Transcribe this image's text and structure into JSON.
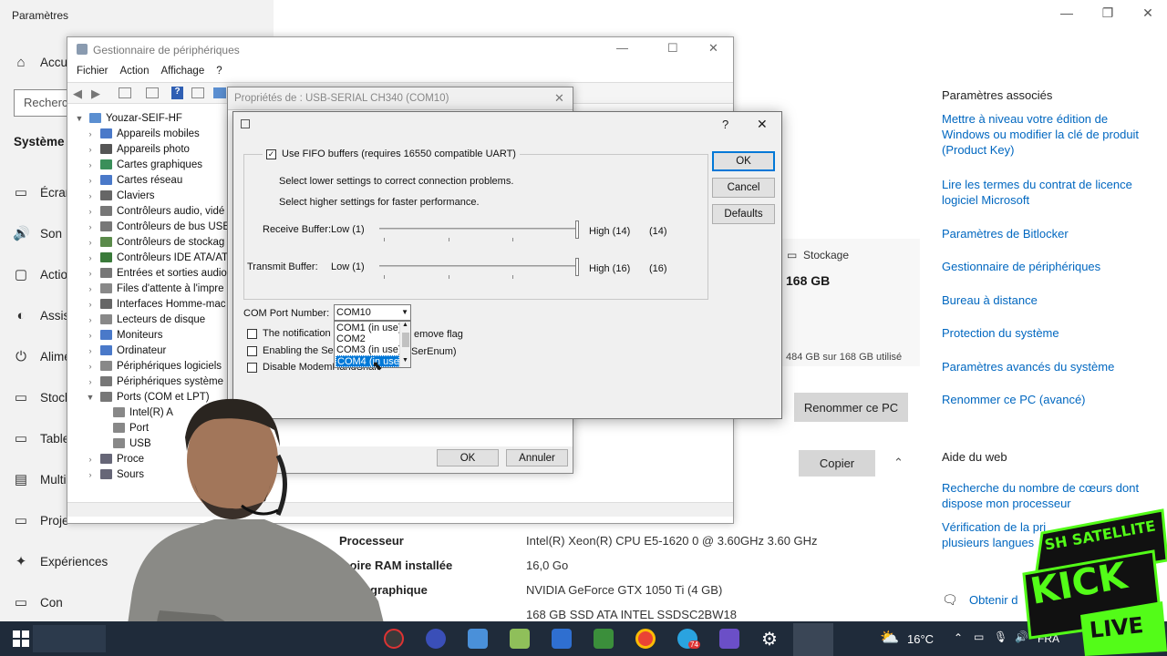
{
  "settings": {
    "window_title": "Paramètres",
    "search_placeholder": "Recherc",
    "nav_home": "Accu",
    "section_title": "Système",
    "nav_items": [
      "Écran",
      "Son",
      "Actio",
      "Assis",
      "Alime",
      "Stock",
      "Table",
      "Multi",
      "Proje",
      "Expériences",
      "Con"
    ],
    "storage_label": "Stockage",
    "storage_size": "168 GB",
    "storage_usage": "484 GB sur 168 GB utilisé",
    "rename_button": "Renommer ce PC",
    "copy_button": "Copier",
    "specs": [
      {
        "label": "Processeur",
        "value": "Intel(R) Xeon(R) CPU E5-1620 0 @ 3.60GHz   3.60 GHz"
      },
      {
        "label": "moire RAM installée",
        "value": "16,0 Go"
      },
      {
        "label": "graphique",
        "value": "NVIDIA GeForce GTX 1050 Ti (4 GB)"
      },
      {
        "label": "e",
        "value": "168 GB SSD ATA INTEL SSDSC2BW18"
      }
    ],
    "related_title": "Paramètres associés",
    "related_links": [
      "Mettre à niveau votre édition de Windows ou modifier la clé de produit (Product Key)",
      "Lire les termes du contrat de licence logiciel Microsoft",
      "Paramètres de Bitlocker",
      "Gestionnaire de périphériques",
      "Bureau à distance",
      "Protection du système",
      "Paramètres avancés du système",
      "Renommer ce PC (avancé)"
    ],
    "web_help_title": "Aide du web",
    "web_help_links": [
      "Recherche du nombre de cœurs dont dispose mon processeur",
      "Vérification de la pri plusieurs langues"
    ],
    "get_help": "Obtenir d"
  },
  "device_manager": {
    "title": "Gestionnaire de périphériques",
    "menu": [
      "Fichier",
      "Action",
      "Affichage",
      "?"
    ],
    "root": "Youzar-SEIF-HF",
    "tree": [
      "Appareils mobiles",
      "Appareils photo",
      "Cartes graphiques",
      "Cartes réseau",
      "Claviers",
      "Contrôleurs audio, vidé",
      "Contrôleurs de bus USE",
      "Contrôleurs de stockag",
      "Contrôleurs IDE ATA/AT",
      "Entrées et sorties audio",
      "Files d'attente à l'impre",
      "Interfaces Homme-mac",
      "Lecteurs de disque",
      "Moniteurs",
      "Ordinateur",
      "Périphériques logiciels",
      "Périphériques système",
      "Ports (COM et LPT)"
    ],
    "ports_children": [
      "Intel(R) A",
      "Port",
      "USB"
    ],
    "tree_after": [
      "Proce",
      "Sours"
    ]
  },
  "properties": {
    "title": "Propriétés de : USB-SERIAL CH340 (COM10)",
    "ok": "OK",
    "cancel": "Annuler"
  },
  "advanced": {
    "help": "?",
    "fifo_label": "Use FIFO buffers (requires 16550 compatible UART)",
    "hint1": "Select lower settings to correct connection problems.",
    "hint2": "Select higher settings for faster performance.",
    "receive_label": "Receive Buffer:",
    "receive_low": "Low (1)",
    "receive_high": "High (14)",
    "receive_value": "(14)",
    "transmit_label": "Transmit Buffer:",
    "transmit_low": "Low (1)",
    "transmit_high": "High (16)",
    "transmit_value": "(16)",
    "com_label": "COM Port Number:",
    "com_selected": "COM10",
    "com_options": [
      "COM1 (in use)",
      "COM2",
      "COM3 (in use)",
      "COM4 (in use)"
    ],
    "check1": "The notification b",
    "check1_tail": "emove flag",
    "check2": "Enabling the Seria",
    "check2_tail": "SerEnum)",
    "check3": "Disable ModemHandShak",
    "ok": "OK",
    "cancel": "Cancel",
    "defaults": "Defaults"
  },
  "taskbar": {
    "weather": "16°C",
    "lang": "FRA",
    "badge": "74"
  },
  "overlay": {
    "logo_top": "SH SATELLITE",
    "logo_mid": "KICK",
    "logo_bottom": "LIVE"
  },
  "colors": {
    "link": "#0067c0",
    "taskbar": "#1f2b3a",
    "selection": "#0078d7",
    "kick_green": "#53fc18"
  }
}
